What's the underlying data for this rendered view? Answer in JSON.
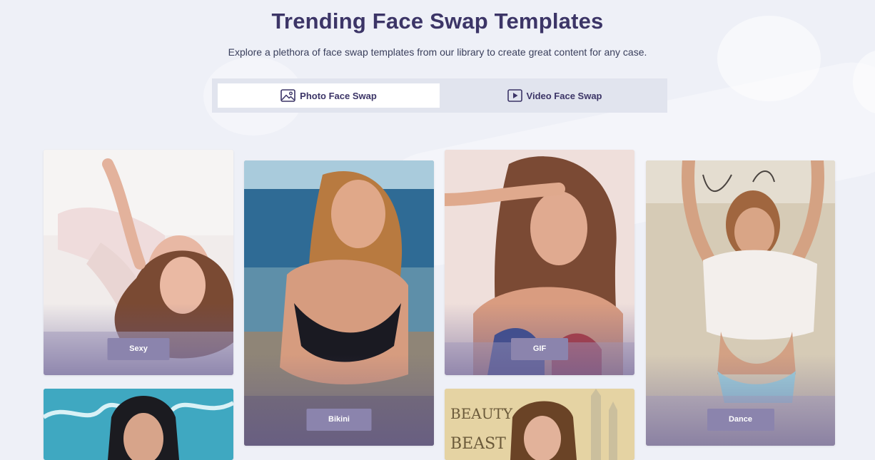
{
  "header": {
    "title": "Trending Face Swap Templates",
    "subtitle": "Explore a plethora of face swap templates from our library to create great content for any case."
  },
  "tabs": [
    {
      "label": "Photo Face Swap",
      "icon": "image-icon",
      "selected": true
    },
    {
      "label": "Video Face Swap",
      "icon": "play-icon",
      "selected": false
    }
  ],
  "templates": [
    {
      "label": "Sexy"
    },
    {
      "label": "Bikini"
    },
    {
      "label": "GIF"
    },
    {
      "label": "Dance"
    },
    {
      "label": ""
    },
    {
      "label": ""
    }
  ],
  "colors": {
    "title": "#3c3567",
    "pill": "#8b84ad",
    "tab_bar": "#e1e4ee",
    "background": "#eef0f7"
  }
}
